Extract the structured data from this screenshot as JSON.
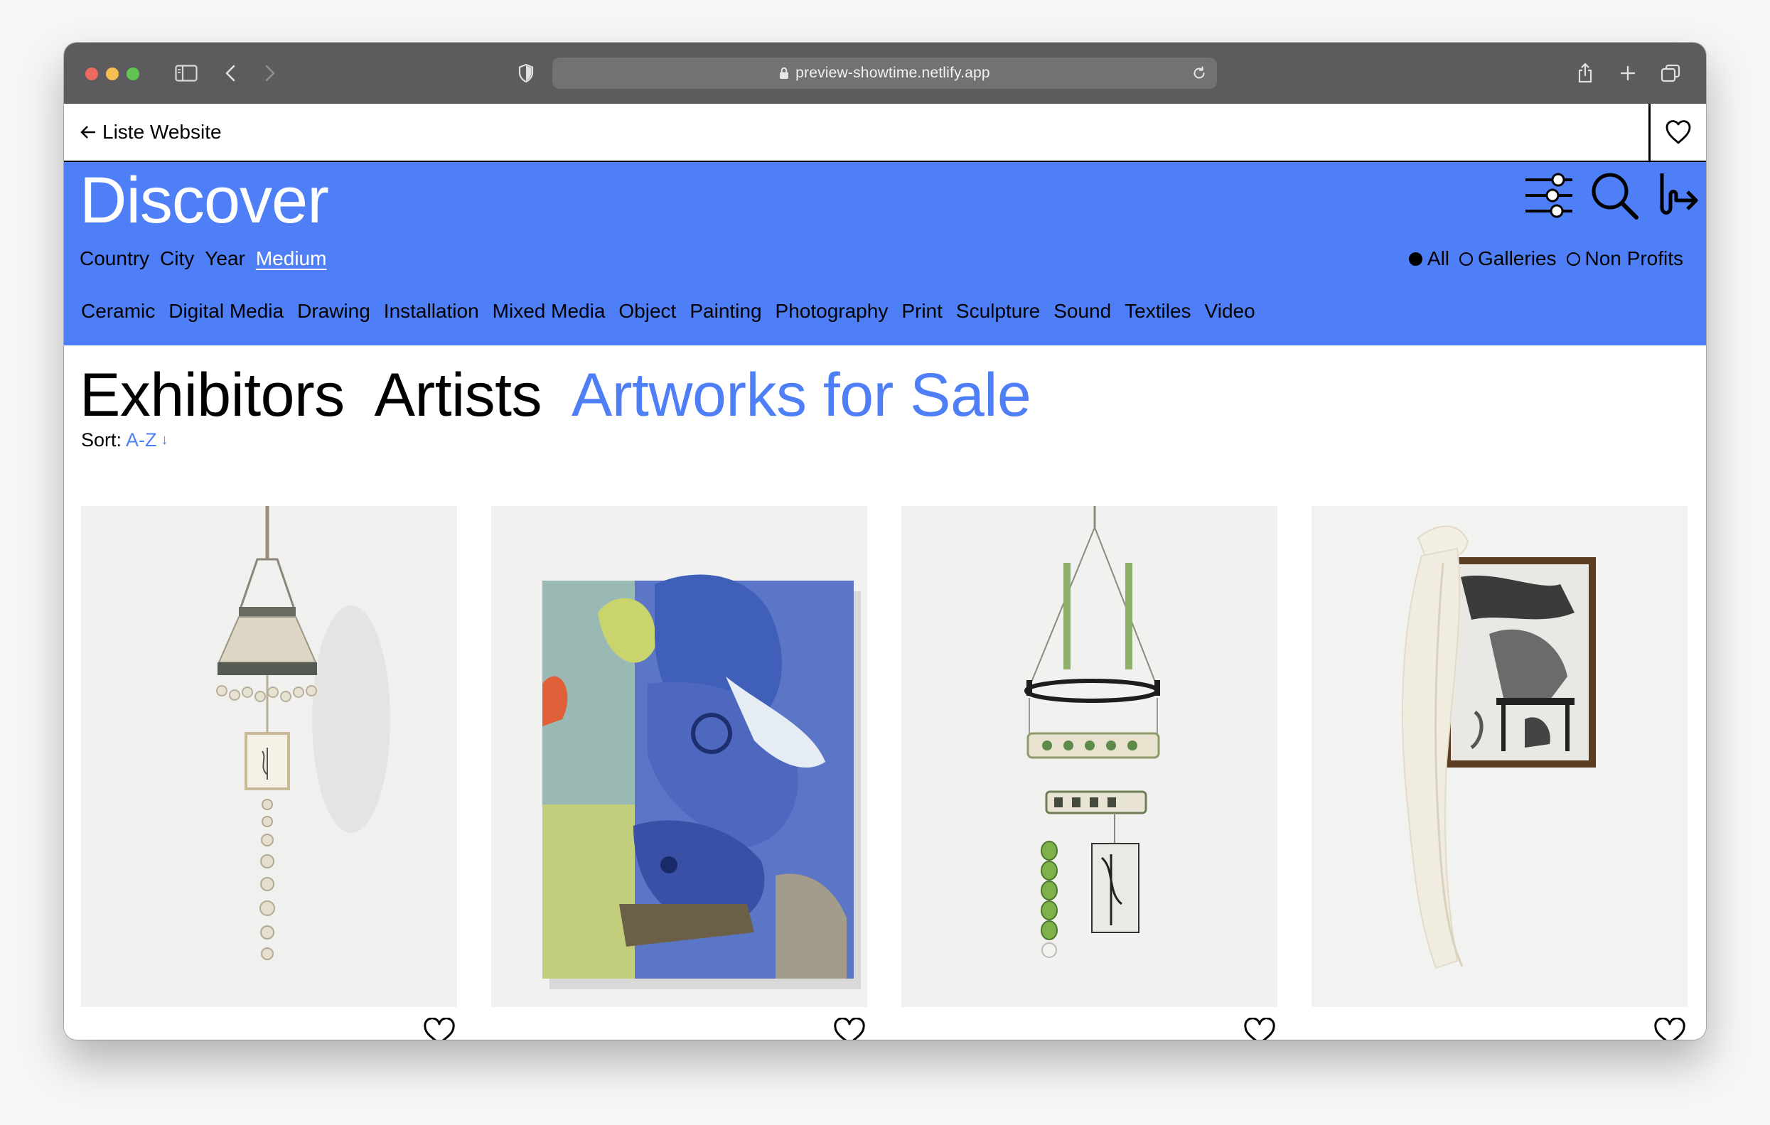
{
  "browser": {
    "url": "preview-showtime.netlify.app"
  },
  "topbar": {
    "back_label": "Liste Website"
  },
  "discover": {
    "title": "Discover",
    "filters": [
      "Country",
      "City",
      "Year",
      "Medium"
    ],
    "active_filter": "Medium",
    "types": [
      {
        "label": "All",
        "selected": true
      },
      {
        "label": "Galleries",
        "selected": false
      },
      {
        "label": "Non Profits",
        "selected": false
      }
    ],
    "mediums": [
      "Ceramic",
      "Digital Media",
      "Drawing",
      "Installation",
      "Mixed Media",
      "Object",
      "Painting",
      "Photography",
      "Print",
      "Sculpture",
      "Sound",
      "Textiles",
      "Video"
    ]
  },
  "tabs": [
    {
      "label": "Exhibitors",
      "active": false
    },
    {
      "label": "Artists",
      "active": false
    },
    {
      "label": "Artworks for Sale",
      "active": true
    }
  ],
  "sort": {
    "label": "Sort:",
    "value": "A-Z",
    "arrow": "↓"
  },
  "colors": {
    "accent": "#4f7ff7",
    "chrome": "#5c5c5e"
  }
}
